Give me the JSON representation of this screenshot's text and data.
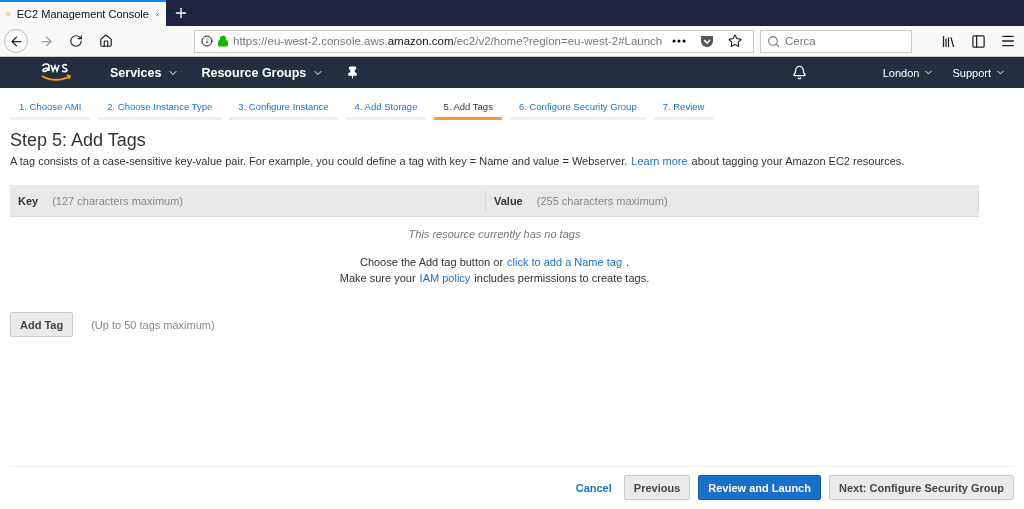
{
  "browser": {
    "tab": {
      "title": "EC2 Management Console",
      "selected": true
    },
    "url": "https://eu-west-2.console.aws.**amazon.com**/ec2/v2/home?region=eu-west-2#Launch",
    "search": {
      "placeholder": "Cerca"
    }
  },
  "aws_nav": {
    "menus": [
      "Services",
      "Resource Groups"
    ],
    "right_menus": [
      "London",
      "Support"
    ]
  },
  "steps": [
    {
      "label": "1. Choose AMI",
      "selected": false
    },
    {
      "label": "2. Choose Instance Type",
      "selected": false
    },
    {
      "label": "3. Configure Instance",
      "selected": false
    },
    {
      "label": "4. Add Storage",
      "selected": false
    },
    {
      "label": "5. Add Tags",
      "selected": true
    },
    {
      "label": "6. Configure Security Group",
      "selected": false
    },
    {
      "label": "7. Review",
      "selected": false
    }
  ],
  "title": "Step 5: Add Tags",
  "description": {
    "before": "A tag consists of a case-sensitive key-value pair. For example, you could define a tag with key = Name and value = Webserver.",
    "link": "Learn more",
    "after": "about tagging your Amazon EC2 resources."
  },
  "table": {
    "columns": [
      {
        "name": "Key",
        "hint": "(127 characters maximum)"
      },
      {
        "name": "Value",
        "hint": "(255 characters maximum)"
      }
    ],
    "empty": "This resource currently has no tags",
    "lines": [
      {
        "before": "Choose the Add tag button or",
        "link": "click to add a Name tag",
        "after": "."
      },
      {
        "before": "Make sure your",
        "link": "IAM policy",
        "after": "includes permissions to create tags."
      }
    ]
  },
  "add_tag": {
    "label": "Add Tag",
    "note": "(Up to 50 tags maximum)"
  },
  "footer": {
    "cancel": "Cancel",
    "previous": "Previous",
    "primary": "Review and Launch",
    "next": "Next: Configure Security Group"
  }
}
